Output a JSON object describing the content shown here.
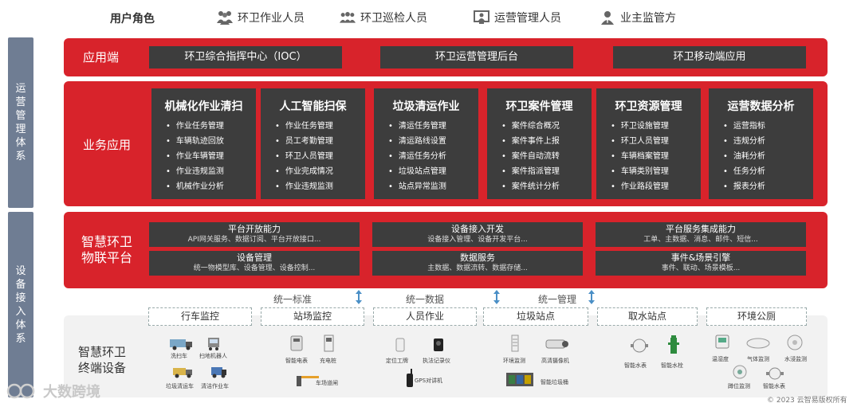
{
  "user_roles": {
    "title": "用户角色",
    "roles": [
      "环卫作业人员",
      "环卫巡检人员",
      "运营管理人员",
      "业主监管方"
    ]
  },
  "sidebar": {
    "top": "运营管理体系",
    "bottom": "设备接入体系"
  },
  "app_layer": {
    "label": "应用端",
    "items": [
      "环卫综合指挥中心（IOC）",
      "环卫运营管理后台",
      "环卫移动端应用"
    ]
  },
  "business": {
    "label": "业务应用",
    "columns": [
      {
        "title": "机械化作业清扫",
        "items": [
          "作业任务管理",
          "车辆轨迹回放",
          "作业车辆管理",
          "作业违规监测",
          "机械作业分析"
        ]
      },
      {
        "title": "人工智能扫保",
        "items": [
          "作业任务管理",
          "员工考勤管理",
          "环卫人员管理",
          "作业完成情况",
          "作业违规监测"
        ]
      },
      {
        "title": "垃圾清运作业",
        "items": [
          "清运任务管理",
          "清运路线设置",
          "清运任务分析",
          "垃圾站点管理",
          "站点异常监测"
        ]
      },
      {
        "title": "环卫案件管理",
        "items": [
          "案件综合概况",
          "案件事件上报",
          "案件自动流转",
          "案件指派管理",
          "案件统计分析"
        ]
      },
      {
        "title": "环卫资源管理",
        "items": [
          "环卫设施管理",
          "环卫人员管理",
          "车辆档案管理",
          "车辆类别管理",
          "作业路段管理"
        ]
      },
      {
        "title": "运营数据分析",
        "items": [
          "运营指标",
          "违规分析",
          "油耗分析",
          "任务分析",
          "报表分析"
        ]
      }
    ]
  },
  "iot": {
    "label_line1": "智慧环卫",
    "label_line2": "物联平台",
    "boxes": [
      {
        "title": "平台开放能力",
        "sub": "API网关服务、数据订阅、平台开放接口..."
      },
      {
        "title": "设备接入开发",
        "sub": "设备接入管理、设备开发平台..."
      },
      {
        "title": "平台服务集成能力",
        "sub": "工单、主数据、消息、邮件、短信..."
      },
      {
        "title": "设备管理",
        "sub": "统一物模型库、设备管理、设备控制..."
      },
      {
        "title": "数据服务",
        "sub": "主数据、数据流转、数据存储..."
      },
      {
        "title": "事件&场景引擎",
        "sub": "事件、联动、场景模板..."
      }
    ]
  },
  "connectors": [
    "统一标准",
    "统一数据",
    "统一管理"
  ],
  "terminal": {
    "label_line1": "智慧环卫",
    "label_line2": "终端设备",
    "categories": [
      "行车监控",
      "站场监控",
      "人员作业",
      "垃圾站点",
      "取水站点",
      "环境公厕"
    ],
    "devices": {
      "xiche": "洗扫车",
      "shoubi": "扫地机器人",
      "laji": "垃圾清运车",
      "qingjie": "清洁作业车",
      "diangui": "智能电表",
      "chongdian": "充电桩",
      "daozha": "车场道闸",
      "gongpai": "定位工牌",
      "zhifa": "执法记录仪",
      "gps": "GPS对讲机",
      "huanjing": "环境监测",
      "gaoqing": "高清摄像机",
      "zhinengtong": "智能垃圾桶",
      "shuibiao": "智能水表",
      "shuishuan": "智能水栓",
      "wenshidu": "温湿度",
      "qiti": "气体监测",
      "shuijin": "水浸监测",
      "kengwei": "蹲位监测",
      "zhinengshui": "智能水表"
    }
  },
  "footer": {
    "logo": "大数跨境",
    "copyright": "© 2023 云智易版权所有"
  },
  "colors": {
    "red": "#d8232b",
    "dark": "#3d3d3d",
    "sidebar": "#6f7d93"
  }
}
